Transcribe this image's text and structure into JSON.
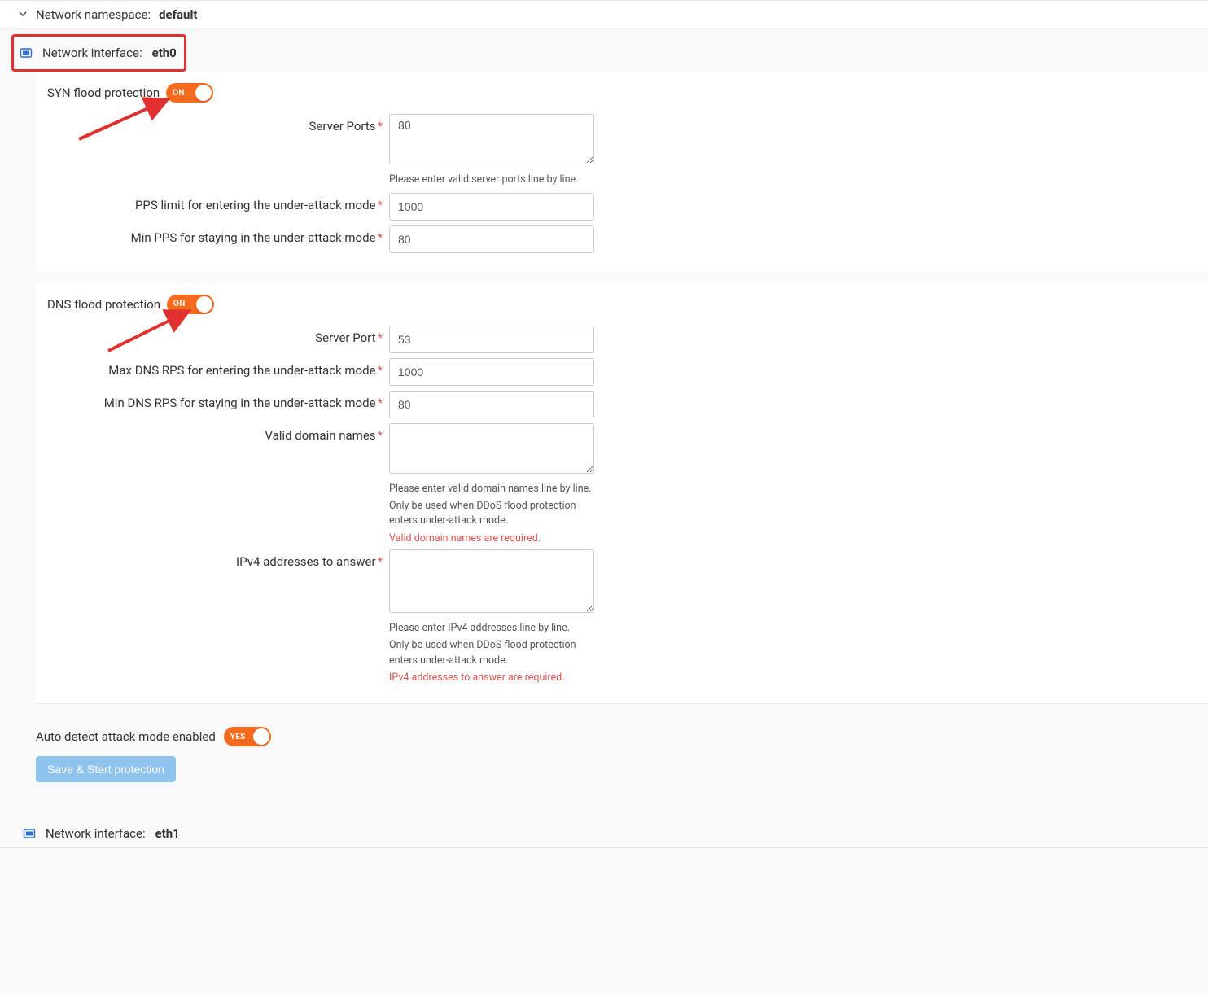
{
  "namespace": {
    "label": "Network namespace:",
    "value": "default"
  },
  "interfaces": [
    {
      "label": "Network interface:",
      "value": "eth0"
    },
    {
      "label": "Network interface:",
      "value": "eth1"
    }
  ],
  "syn": {
    "title": "SYN flood protection",
    "toggle_text": "ON",
    "server_ports_label": "Server Ports",
    "server_ports_value": "80",
    "server_ports_hint": "Please enter valid server ports line by line.",
    "pps_limit_label": "PPS limit for entering the under-attack mode",
    "pps_limit_value": "1000",
    "min_pps_label": "Min PPS for staying in the under-attack mode",
    "min_pps_value": "80"
  },
  "dns": {
    "title": "DNS flood protection",
    "toggle_text": "ON",
    "server_port_label": "Server Port",
    "server_port_value": "53",
    "max_rps_label": "Max DNS RPS for entering the under-attack mode",
    "max_rps_value": "1000",
    "min_rps_label": "Min DNS RPS for staying in the under-attack mode",
    "min_rps_value": "80",
    "valid_domains_label": "Valid domain names",
    "valid_domains_value": "",
    "valid_domains_hint1": "Please enter valid domain names line by line.",
    "valid_domains_hint2": "Only be used when DDoS flood protection enters under-attack mode.",
    "valid_domains_err": "Valid domain names are required.",
    "ipv4_label": "IPv4 addresses to answer",
    "ipv4_value": "",
    "ipv4_hint1": "Please enter IPv4 addresses line by line.",
    "ipv4_hint2": "Only be used when DDoS flood protection enters under-attack mode.",
    "ipv4_err": "IPv4 addresses to answer are required."
  },
  "auto_detect": {
    "label": "Auto detect attack mode enabled",
    "toggle_text": "YES"
  },
  "save_btn": "Save & Start protection"
}
